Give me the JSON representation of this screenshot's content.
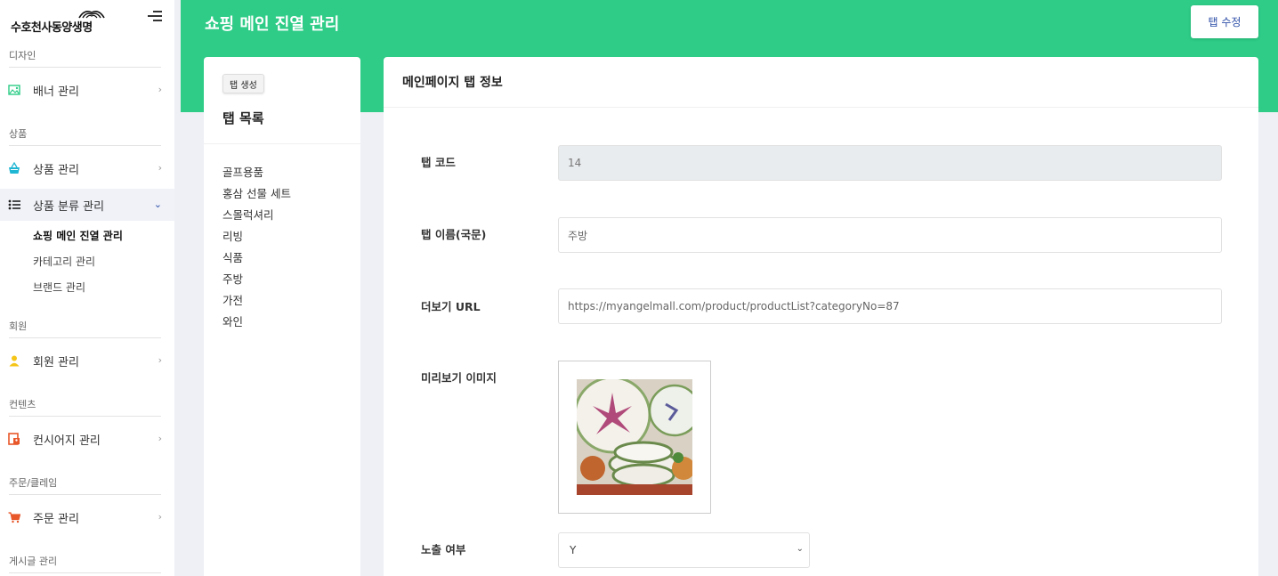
{
  "brand": {
    "name": "수호천사동양생명"
  },
  "sidebar": {
    "sections": [
      {
        "title": "디자인"
      },
      {
        "title": "상품"
      },
      {
        "title": "회원"
      },
      {
        "title": "컨텐츠"
      },
      {
        "title": "주문/클레임"
      },
      {
        "title": "게시글 관리"
      }
    ],
    "items": [
      {
        "label": "배너 관리",
        "icon": "image-icon"
      },
      {
        "label": "상품 관리",
        "icon": "basket-icon"
      },
      {
        "label": "상품 분류 관리",
        "icon": "list-icon"
      },
      {
        "label": "회원 관리",
        "icon": "user-icon"
      },
      {
        "label": "컨시어지 관리",
        "icon": "concierge-icon"
      },
      {
        "label": "주문 관리",
        "icon": "cart-icon"
      }
    ],
    "sub_items": [
      "쇼핑 메인 진열 관리",
      "카테고리 관리",
      "브랜드 관리"
    ],
    "colors": {
      "image": "#2ecc87",
      "basket": "#1fb6d4",
      "user": "#f5c518",
      "concierge": "#e8572a",
      "cart": "#e8572a"
    }
  },
  "header": {
    "title": "쇼핑 메인 진열 관리",
    "edit_button": "탭 수정",
    "accent": "#2ecc87"
  },
  "tab_panel": {
    "create_button": "탭 생성",
    "title": "탭 목록",
    "tabs": [
      "골프용품",
      "홍삼 선물 세트",
      "스몰럭셔리",
      "리빙",
      "식품",
      "주방",
      "가전",
      "와인"
    ]
  },
  "info_panel": {
    "title": "메인페이지 탭 정보",
    "fields": {
      "code": {
        "label": "탭 코드",
        "value": "14"
      },
      "name": {
        "label": "탭 이름(국문)",
        "value": "주방"
      },
      "more_url": {
        "label": "더보기 URL",
        "value": "https://myangelmall.com/product/productList?categoryNo=87"
      },
      "preview": {
        "label": "미리보기 이미지"
      },
      "visible": {
        "label": "노출 여부",
        "value": "Y"
      }
    }
  }
}
